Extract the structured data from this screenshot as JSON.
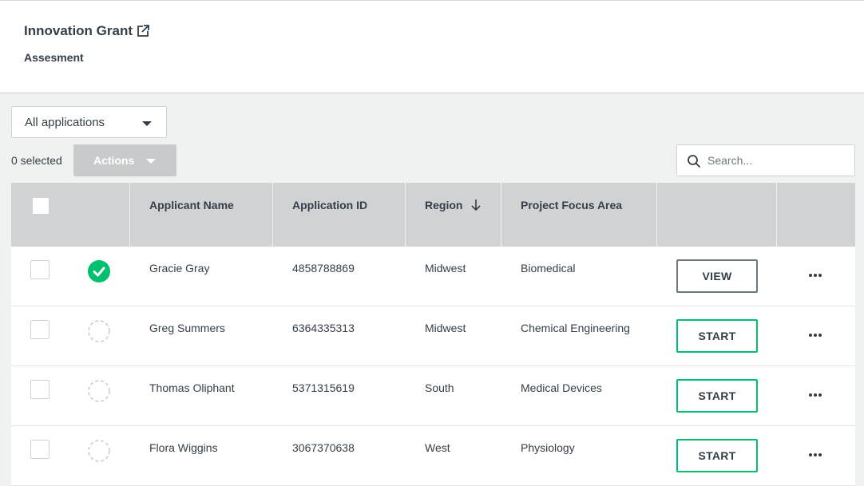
{
  "header": {
    "title": "Innovation Grant",
    "subtitle": "Assesment"
  },
  "filter": {
    "selected": "All applications"
  },
  "toolbar": {
    "selected_count": "0 selected",
    "actions_label": "Actions",
    "search_placeholder": "Search..."
  },
  "table": {
    "columns": [
      "",
      "",
      "Applicant Name",
      "Application ID",
      "Region",
      "Project Focus Area",
      "",
      ""
    ],
    "sorted_column": "Region",
    "rows": [
      {
        "name": "Gracie Gray",
        "id": "4858788869",
        "region": "Midwest",
        "focus": "Biomedical",
        "status": "complete",
        "action": "VIEW"
      },
      {
        "name": "Greg Summers",
        "id": "6364335313",
        "region": "Midwest",
        "focus": "Chemical Engineering",
        "status": "pending",
        "action": "START"
      },
      {
        "name": "Thomas Oliphant",
        "id": "5371315619",
        "region": "South",
        "focus": "Medical Devices",
        "status": "pending",
        "action": "START"
      },
      {
        "name": "Flora Wiggins",
        "id": "3067370638",
        "region": "West",
        "focus": "Physiology",
        "status": "pending",
        "action": "START"
      }
    ]
  },
  "colors": {
    "accent_green": "#00bf6f",
    "header_gray": "#d0d2d3",
    "text": "#333e48",
    "disabled_button": "#c8cacc"
  },
  "icons": {
    "external": "external-link-icon",
    "search": "search-icon",
    "sort": "arrow-down-icon",
    "complete": "check-circle-icon",
    "pending": "dashed-circle-icon",
    "more": "more-horizontal-icon"
  }
}
